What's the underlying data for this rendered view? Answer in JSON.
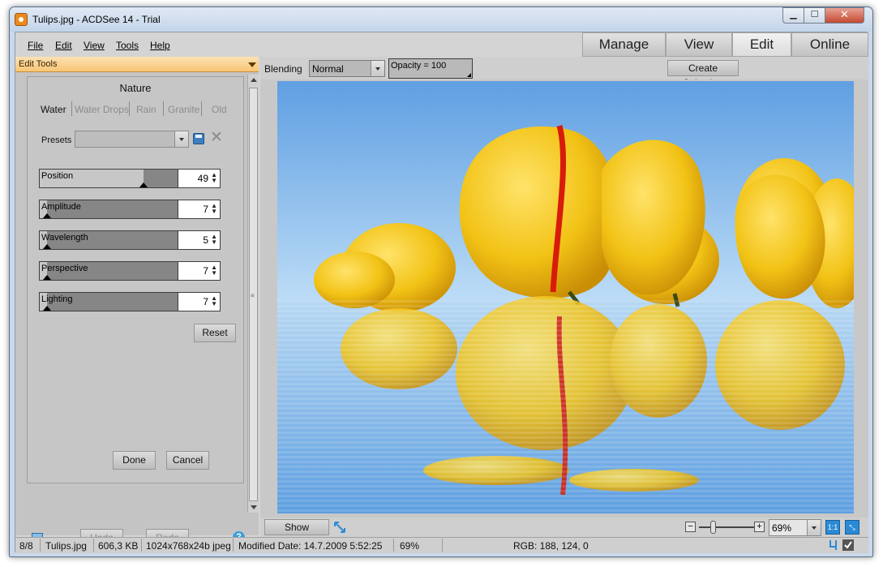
{
  "window": {
    "title": "Tulips.jpg - ACDSee 14 - Trial",
    "close_glyph": "✕",
    "min_glyph": "▁",
    "max_glyph": "☐"
  },
  "menu": {
    "items": [
      "File",
      "Edit",
      "View",
      "Tools",
      "Help"
    ]
  },
  "mode_tabs": [
    "Manage",
    "View",
    "Edit",
    "Online"
  ],
  "panel": {
    "header": "Edit Tools",
    "effect_title": "Nature",
    "subtabs": [
      "Water",
      "Water Drops",
      "Rain",
      "Granite",
      "Old"
    ],
    "presets_label": "Presets",
    "presets_value": "",
    "sliders": [
      {
        "label": "Position",
        "value": "49",
        "fraction": 0.75
      },
      {
        "label": "Amplitude",
        "value": "7",
        "fraction": 0.05
      },
      {
        "label": "Wavelength",
        "value": "5",
        "fraction": 0.05
      },
      {
        "label": "Perspective",
        "value": "7",
        "fraction": 0.05
      },
      {
        "label": "Lighting",
        "value": "7",
        "fraction": 0.05
      }
    ],
    "reset_label": "Reset",
    "done_label": "Done",
    "cancel_label": "Cancel",
    "undo_label": "Undo",
    "redo_label": "Redo",
    "help_glyph": "?"
  },
  "toolbar": {
    "blending_label": "Blending",
    "blending_value": "Normal",
    "opacity_label": "Opacity = 100",
    "create_selection_label": "Create Selection"
  },
  "bottombar": {
    "show_previous_label": "Show Previous",
    "zoom_value": "69%",
    "actual_size_glyph": "1:1",
    "zoom_minus": "−",
    "zoom_plus": "+"
  },
  "status": {
    "index": "8/8",
    "filename": "Tulips.jpg",
    "filesize": "606,3 KB",
    "dimensions": "1024x768x24b jpeg",
    "modified": "Modified Date: 14.7.2009 5:52:25",
    "zoom": "69%",
    "rgb": "RGB: 188, 124, 0"
  },
  "colors": {
    "panel_header": "#f8c575",
    "sky_top": "#6aa7e6",
    "sky_bottom": "#b9daf5",
    "tulip_yellow": "#f2c316",
    "tulip_stripe": "#d81b0a"
  }
}
